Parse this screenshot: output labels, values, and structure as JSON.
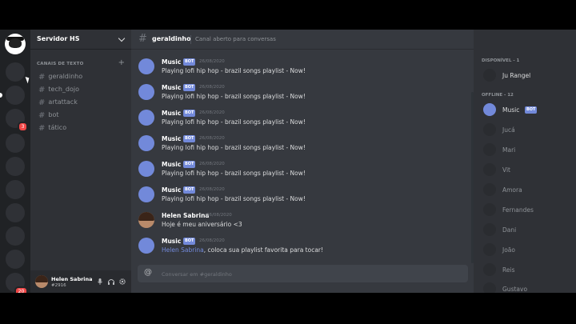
{
  "server": {
    "name": "Servidor HS",
    "badges": [
      "3",
      "20"
    ]
  },
  "channels": {
    "category": "CANAIS DE TEXTO",
    "items": [
      {
        "label": "geraldinho"
      },
      {
        "label": "tech_dojo"
      },
      {
        "label": "artattack"
      },
      {
        "label": "bot"
      },
      {
        "label": "tático"
      }
    ]
  },
  "current_user": {
    "name": "Helen Sabrina",
    "tag": "#2916"
  },
  "chat": {
    "channel_name": "geraldinho",
    "topic": "Canal aberto para conversas",
    "bot_tag": "BOT",
    "messages": [
      {
        "author": "Music",
        "timestamp": "26/08/2020",
        "text": "Playing lofi hip hop - brazil songs playlist - Now!"
      },
      {
        "author": "Music",
        "timestamp": "26/08/2020",
        "text": "Playing lofi hip hop - brazil songs playlist - Now!"
      },
      {
        "author": "Music",
        "timestamp": "26/08/2020",
        "text": "Playing lofi hip hop - brazil songs playlist - Now!"
      },
      {
        "author": "Music",
        "timestamp": "26/08/2020",
        "text": "Playing lofi hip hop - brazil songs playlist - Now!"
      },
      {
        "author": "Music",
        "timestamp": "26/08/2020",
        "text": "Playing lofi hip hop - brazil songs playlist - Now!"
      },
      {
        "author": "Music",
        "timestamp": "26/08/2020",
        "text": "Playing lofi hip hop - brazil songs playlist - Now!"
      },
      {
        "author": "Helen Sabrina",
        "timestamp": "26/08/2020",
        "text": "Hoje é meu aniversário <3"
      },
      {
        "author": "Music",
        "timestamp": "26/08/2020",
        "mention": "Helen Sabrina",
        "text": ", coloca sua playlist favorita para tocar!"
      }
    ],
    "composer_placeholder": "Conversar em #geraldinho"
  },
  "members": {
    "online_header": "DISPONÍVEL - 1",
    "offline_header": "OFFLINE - 12",
    "online": [
      {
        "name": "Ju Rangel"
      }
    ],
    "offline": [
      {
        "name": "Music",
        "bot": "BOT"
      },
      {
        "name": "Jucá"
      },
      {
        "name": "Mari"
      },
      {
        "name": "Vit"
      },
      {
        "name": "Amora"
      },
      {
        "name": "Fernandes"
      },
      {
        "name": "Dani"
      },
      {
        "name": "João"
      },
      {
        "name": "Reis"
      },
      {
        "name": "Gustavo"
      }
    ]
  },
  "icons": [
    "home-icon",
    "hash-icon",
    "chevron-down-icon",
    "plus-icon",
    "microphone-icon",
    "headphones-icon",
    "gear-icon",
    "at-icon"
  ],
  "colors": {
    "blurple": "#7289da",
    "background": "#36393f",
    "sidebar": "#2f3136",
    "rail": "#202225",
    "danger": "#f04747"
  }
}
